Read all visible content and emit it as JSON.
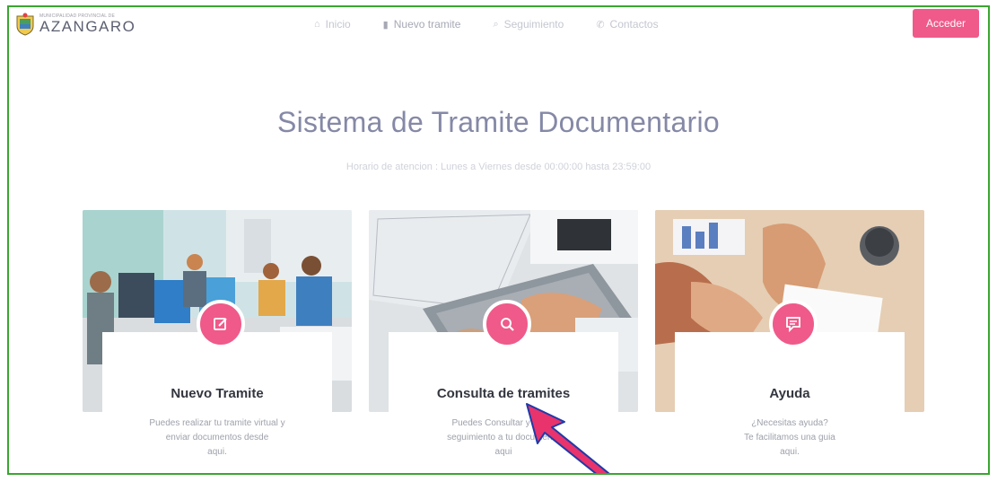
{
  "header": {
    "logo_small": "MUNICIPALIDAD PROVINCIAL DE",
    "logo_text": "AZANGARO",
    "nav": [
      {
        "icon": "⌂",
        "label": "Inicio"
      },
      {
        "icon": "▮",
        "label": "Nuevo tramite"
      },
      {
        "icon": "⌕",
        "label": "Seguimiento"
      },
      {
        "icon": "✆",
        "label": "Contactos"
      }
    ],
    "login_label": "Acceder"
  },
  "hero": {
    "title": "Sistema de Tramite Documentario",
    "subtitle": "Horario de atencion : Lunes a Viernes desde 00:00:00 hasta 23:59:00"
  },
  "cards": [
    {
      "icon": "edit-icon",
      "title": "Nuevo Tramite",
      "desc_lines": [
        "Puedes realizar tu tramite virtual y",
        "enviar documentos desde",
        "aqui."
      ]
    },
    {
      "icon": "search-icon",
      "title": "Consulta de tramites",
      "desc_lines": [
        "Puedes Consultar y hacer",
        "seguimiento a tu documento",
        "aqui"
      ]
    },
    {
      "icon": "chat-icon",
      "title": "Ayuda",
      "desc_lines": [
        "¿Necesitas ayuda?",
        "Te facilitamos una guia",
        "aqui."
      ]
    }
  ],
  "colors": {
    "accent": "#ef5a8a",
    "title": "#8589a6",
    "border": "#39a62f",
    "arrow": "#e8336d"
  }
}
